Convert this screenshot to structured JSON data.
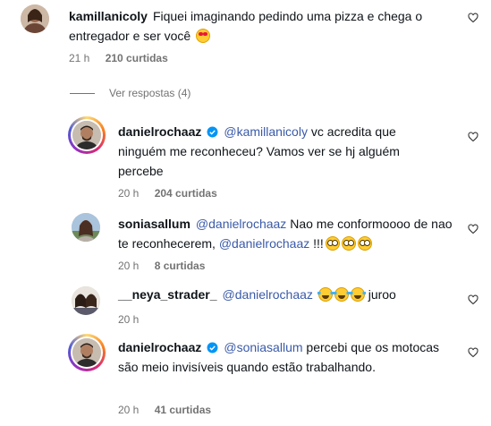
{
  "comments": [
    {
      "username": "kamillanicoly",
      "text": "Fiquei imaginando pedindo uma pizza e chega o entregador e ser você",
      "emoji": [
        "heart-eyes"
      ],
      "time": "21 h",
      "likes": "210 curtidas"
    },
    {
      "username": "danielrochaaz",
      "verified": true,
      "mention": "@kamillanicoly",
      "text": "vc acredita que ninguém me reconheceu? Vamos ver se hj alguém percebe",
      "time": "20 h",
      "likes": "204 curtidas"
    },
    {
      "username": "soniasallum",
      "mention": "@danielrochaaz",
      "text1": "Nao me conformoooo de nao te reconhecerem,",
      "mention2": "@danielrochaaz",
      "text2": "!!!",
      "emoji": [
        "flushed",
        "flushed",
        "flushed"
      ],
      "time": "20 h",
      "likes": "8 curtidas"
    },
    {
      "username": "__neya_strader_",
      "mention": "@danielrochaaz",
      "emoji": [
        "joy",
        "joy",
        "joy"
      ],
      "text": "juroo",
      "time": "20 h"
    },
    {
      "username": "danielrochaaz",
      "verified": true,
      "mention": "@soniasallum",
      "text": "percebi que os motocas são meio invisíveis quando estão trabalhando.",
      "time": "20 h",
      "likes": "41 curtidas"
    }
  ],
  "view_replies": "Ver respostas (4)",
  "colors": {
    "mention": "#3a5aa8",
    "meta": "#737373",
    "verified": "#0095f6"
  },
  "icons": {
    "like": "heart-outline-icon",
    "verified": "verified-badge-icon"
  }
}
